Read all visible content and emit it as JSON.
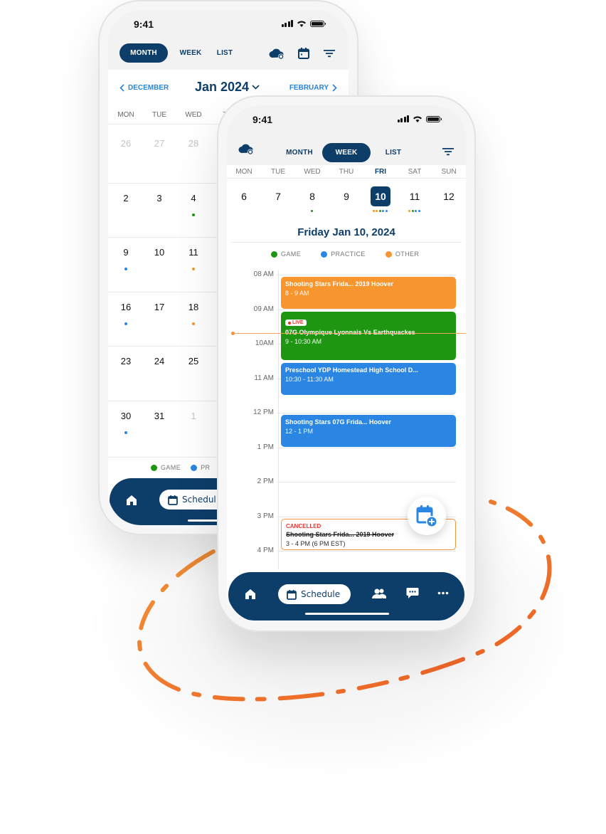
{
  "colors": {
    "navy": "#0d3e6a",
    "link_blue": "#2a86d8",
    "game": "#1e9612",
    "practice": "#2a86e2",
    "other": "#f7952f",
    "live_red": "#e53935",
    "ring_orange": "#f0742a"
  },
  "back_phone": {
    "status": {
      "time": "9:41"
    },
    "view_tabs": [
      {
        "label": "MONTH",
        "active": true
      },
      {
        "label": "WEEK",
        "active": false
      },
      {
        "label": "LIST",
        "active": false
      }
    ],
    "toolbar_icons": [
      "cloud-sync-icon",
      "calendar-icon",
      "filter-icon"
    ],
    "month_nav": {
      "prev": "DECEMBER",
      "title": "Jan 2024",
      "next": "FEBRUARY"
    },
    "weekdays": [
      "MON",
      "TUE",
      "WED",
      "TH"
    ],
    "weeks": [
      [
        {
          "d": "26",
          "muted": true
        },
        {
          "d": "27",
          "muted": true
        },
        {
          "d": "28",
          "muted": true
        }
      ],
      [
        {
          "d": "2"
        },
        {
          "d": "3"
        },
        {
          "d": "4",
          "dot": "game"
        }
      ],
      [
        {
          "d": "9",
          "dot": "practice"
        },
        {
          "d": "10"
        },
        {
          "d": "11",
          "dot": "other"
        }
      ],
      [
        {
          "d": "16",
          "dot": "practice"
        },
        {
          "d": "17"
        },
        {
          "d": "18",
          "dot": "other"
        }
      ],
      [
        {
          "d": "23"
        },
        {
          "d": "24"
        },
        {
          "d": "25"
        }
      ],
      [
        {
          "d": "30",
          "dot": "practice"
        },
        {
          "d": "31"
        },
        {
          "d": "1",
          "muted": true
        }
      ]
    ],
    "legend": [
      {
        "label": "GAME",
        "type": "game"
      },
      {
        "label": "PR",
        "type": "practice"
      }
    ],
    "bottom_nav": {
      "schedule_label": "Schedul"
    }
  },
  "front_phone": {
    "status": {
      "time": "9:41"
    },
    "view_tabs": [
      {
        "label": "MONTH",
        "active": false
      },
      {
        "label": "WEEK",
        "active": true
      },
      {
        "label": "LIST",
        "active": false
      }
    ],
    "week": [
      {
        "dow": "MON",
        "day": "6",
        "dots": []
      },
      {
        "dow": "TUE",
        "day": "7",
        "dots": []
      },
      {
        "dow": "WED",
        "day": "8",
        "dots": [
          "game"
        ]
      },
      {
        "dow": "THU",
        "day": "9",
        "dots": []
      },
      {
        "dow": "FRI",
        "day": "10",
        "active": true,
        "dots": [
          "other",
          "other",
          "game",
          "practice",
          "practice"
        ]
      },
      {
        "dow": "SAT",
        "day": "11",
        "dots": [
          "other",
          "game",
          "practice",
          "practice"
        ]
      },
      {
        "dow": "SUN",
        "day": "12",
        "dots": []
      }
    ],
    "day_title": "Friday Jan 10, 2024",
    "legend": [
      {
        "label": "GAME",
        "type": "game"
      },
      {
        "label": "PRACTICE",
        "type": "practice"
      },
      {
        "label": "OTHER",
        "type": "other"
      }
    ],
    "hours": [
      "08 AM",
      "09 AM",
      "10AM",
      "11 AM",
      "12 PM",
      "1 PM",
      "2 PM",
      "3 PM",
      "4 PM"
    ],
    "events": [
      {
        "title": "Shooting Stars Frida... 2019 Hoover",
        "time": "8 - 9 AM",
        "type": "other",
        "start": 8,
        "end": 9
      },
      {
        "title": "07G Olympique Lyonnais Vs Earthquackes",
        "time": "9 - 10:30 AM",
        "type": "game",
        "start": 9,
        "end": 10.5,
        "live": true,
        "live_label": "LIVE"
      },
      {
        "title": "Preschool YDP Homestead High School D...",
        "time": "10:30 - 11:30 AM",
        "type": "practice",
        "start": 10.5,
        "end": 11.5
      },
      {
        "title": "Shooting Stars 07G Frida... Hoover",
        "time": "12 - 1 PM",
        "type": "practice",
        "start": 12,
        "end": 13
      },
      {
        "title": "Shooting Stars Frida... 2019 Hoover",
        "time": "3 - 4 PM (6 PM EST)",
        "type": "other",
        "start": 15,
        "end": 16,
        "cancelled": true,
        "cancelled_label": "CANCELLED"
      }
    ],
    "now_time": 9.7,
    "bottom_nav": {
      "schedule_label": "Schedule",
      "items": [
        "home-icon",
        "schedule",
        "team-icon",
        "chat-icon",
        "more-icon"
      ]
    }
  }
}
